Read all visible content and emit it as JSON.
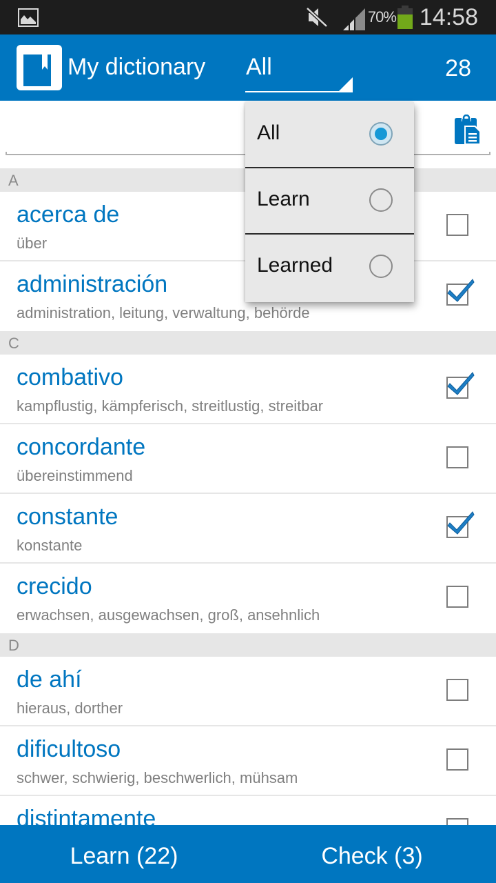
{
  "status_bar": {
    "left_icon": "gallery-icon",
    "icons": [
      "mute-icon",
      "signal-icon",
      "battery-icon"
    ],
    "battery_percent": "70%",
    "battery_level": 0.7,
    "time": "14:58"
  },
  "app_bar": {
    "logo_icon": "dictionary-book-icon",
    "title": "My dictionary",
    "filter_value": "All",
    "word_count": "28"
  },
  "search": {
    "value": "",
    "placeholder": "",
    "paste_icon": "clipboard-icon"
  },
  "filter_dropdown": {
    "options": [
      {
        "label": "All",
        "selected": true
      },
      {
        "label": "Learn",
        "selected": false
      },
      {
        "label": "Learned",
        "selected": false
      }
    ]
  },
  "list": {
    "sections": [
      {
        "letter": "A",
        "entries": [
          {
            "word": "acerca de",
            "translation": "über",
            "checked": false
          },
          {
            "word": "administración",
            "translation": "administration, leitung, verwaltung, behörde",
            "checked": true
          }
        ]
      },
      {
        "letter": "C",
        "entries": [
          {
            "word": "combativo",
            "translation": "kampflustig, kämpferisch, streitlustig, streitbar",
            "checked": true
          },
          {
            "word": "concordante",
            "translation": "übereinstimmend",
            "checked": false
          },
          {
            "word": "constante",
            "translation": "konstante",
            "checked": true
          },
          {
            "word": "crecido",
            "translation": "erwachsen, ausgewachsen, groß, ansehnlich",
            "checked": false
          }
        ]
      },
      {
        "letter": "D",
        "entries": [
          {
            "word": "de ahí",
            "translation": "hieraus, dorther",
            "checked": false
          },
          {
            "word": "dificultoso",
            "translation": "schwer, schwierig, beschwerlich, mühsam",
            "checked": false
          },
          {
            "word": "distintamente",
            "translation": "",
            "checked": false
          }
        ]
      }
    ]
  },
  "bottom_bar": {
    "learn_label": "Learn (22)",
    "check_label": "Check (3)"
  },
  "colors": {
    "primary": "#0076c0",
    "status_bar": "#1d1d1d",
    "section_header": "#e6e6e6",
    "translation_text": "#808080",
    "radio_selected": "#1598d6",
    "battery": "#72a91a"
  }
}
